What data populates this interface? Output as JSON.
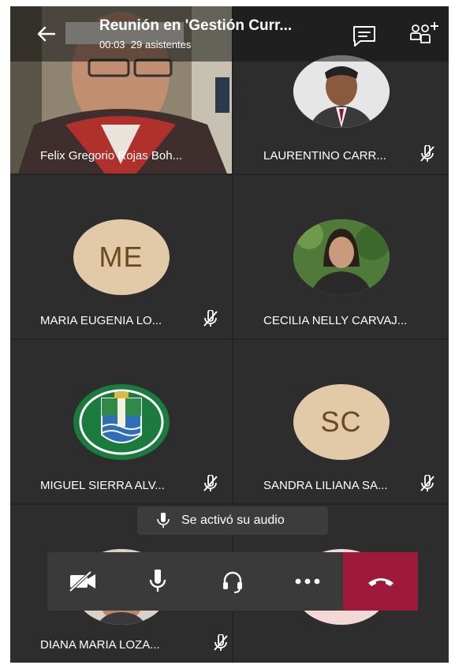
{
  "meeting": {
    "title": "Reunión en 'Gestión Curr...",
    "duration": "00:03",
    "attendees": "29 asistentes"
  },
  "participants": [
    {
      "name": "Felix Gregorio Rojas Boh...",
      "muted": false,
      "video": true
    },
    {
      "name": "LAURENTINO CARR...",
      "muted": true
    },
    {
      "name": "MARIA EUGENIA LO...",
      "muted": true,
      "initials": "ME"
    },
    {
      "name": "CECILIA NELLY CARVAJ...",
      "muted": false
    },
    {
      "name": "MIGUEL SIERRA ALV...",
      "muted": true
    },
    {
      "name": "SANDRA LILIANA SA...",
      "muted": true,
      "initials": "SC"
    },
    {
      "name": "DIANA MARIA LOZA...",
      "muted": true
    }
  ],
  "toast": {
    "text": "Se activó su audio"
  },
  "icons": [
    "back-arrow-icon",
    "chat-icon",
    "add-people-icon",
    "microphone-icon",
    "muted-mic-icon",
    "video-off-icon",
    "headset-icon",
    "more-icon",
    "hang-up-icon"
  ],
  "colors": {
    "background": "#242424",
    "tile": "#2d2d2d",
    "avatar": "#e2c9a8",
    "hangup": "#9e1a3a"
  }
}
